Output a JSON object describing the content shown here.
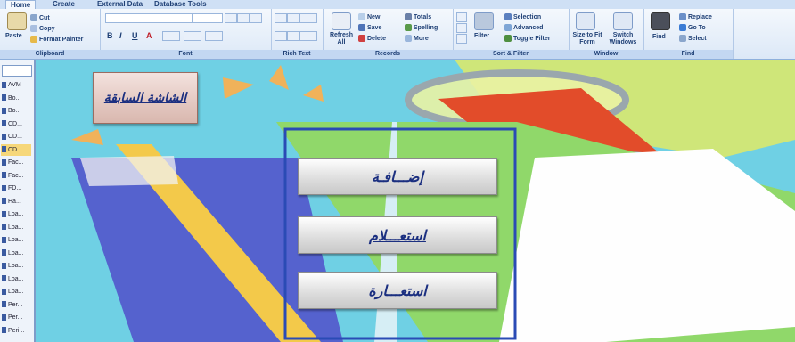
{
  "ribbon": {
    "tabs": [
      "Home",
      "Create",
      "External Data",
      "Database Tools"
    ],
    "clipboard": {
      "label": "Clipboard",
      "paste": "Paste",
      "cut": "Cut",
      "copy": "Copy",
      "format_painter": "Format Painter"
    },
    "font": {
      "label": "Font",
      "bold": "B",
      "italic": "I",
      "underline": "U",
      "color": "A"
    },
    "rich_text": {
      "label": "Rich Text"
    },
    "records": {
      "label": "Records",
      "refresh": "Refresh All",
      "new": "New",
      "save": "Save",
      "delete": "Delete",
      "totals": "Totals",
      "spelling": "Spelling",
      "more": "More"
    },
    "sort_filter": {
      "label": "Sort & Filter",
      "filter": "Filter",
      "selection": "Selection",
      "advanced": "Advanced",
      "toggle_filter": "Toggle Filter"
    },
    "window": {
      "label": "Window",
      "size_to_fit": "Size to Fit Form",
      "switch_windows": "Switch Windows"
    },
    "find": {
      "label": "Find",
      "find": "Find",
      "replace": "Replace",
      "go_to": "Go To",
      "select": "Select"
    }
  },
  "nav": {
    "items": [
      "AVM",
      "Bo...",
      "Bo...",
      "CD...",
      "CD...",
      "CD...",
      "Fac...",
      "Fac...",
      "FD...",
      "Ha...",
      "Loa...",
      "Loa...",
      "Loa...",
      "Loa...",
      "Loa...",
      "Loa...",
      "Loa...",
      "Per...",
      "Per...",
      "Peri..."
    ],
    "selected_index": 5
  },
  "form": {
    "previous_screen": "الشاشة السابقة",
    "buttons": [
      "إضـــافـة",
      "استعـــلام",
      "استعـــارة"
    ]
  },
  "colors": {
    "background": "#6fd0e4",
    "button_text": "#1b2f80",
    "ribbon": "#dce8f7"
  }
}
